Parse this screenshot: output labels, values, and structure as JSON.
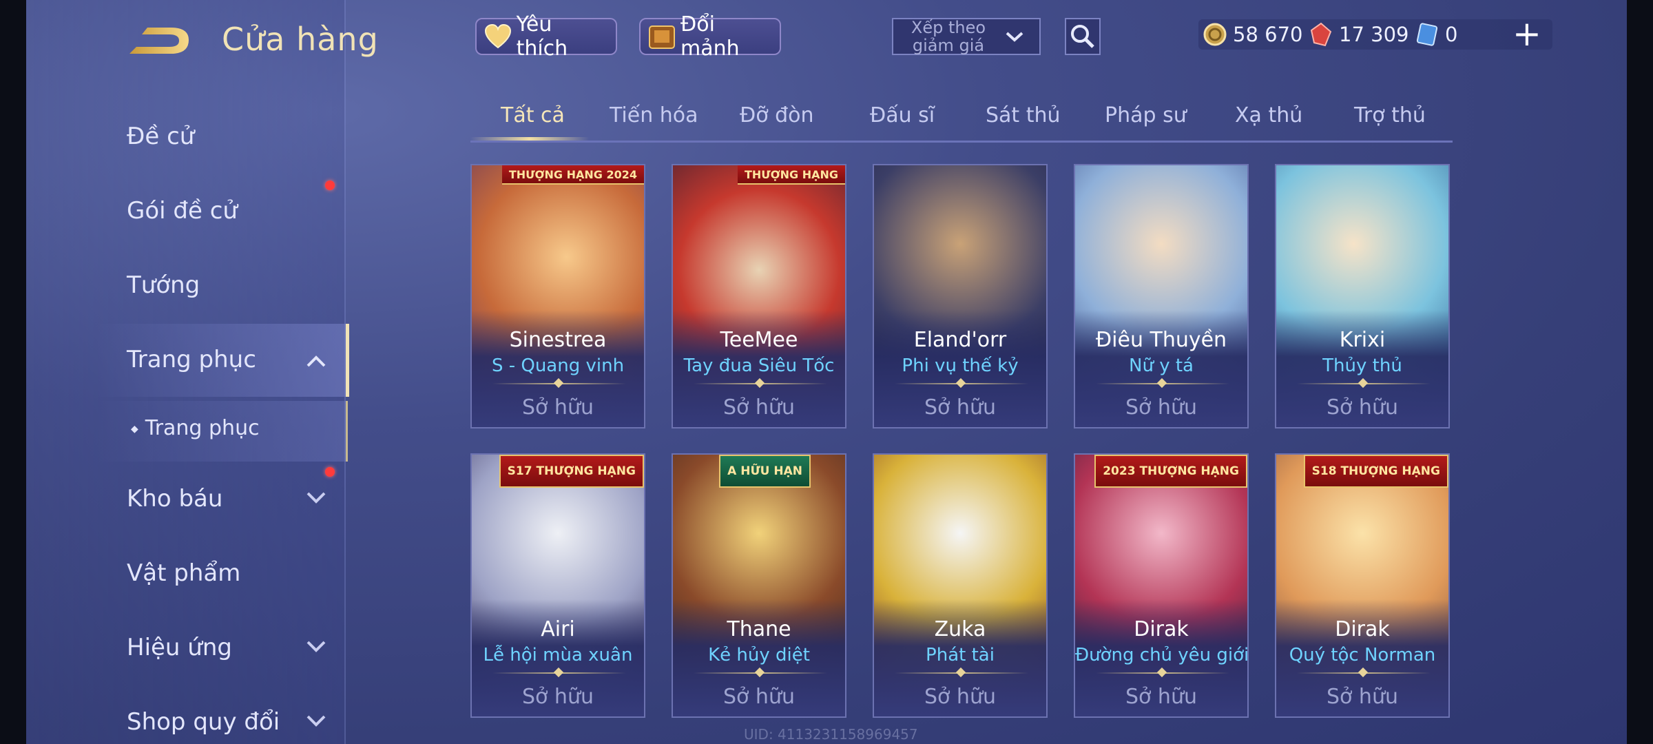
{
  "header": {
    "title": "Cửa hàng",
    "favorite_label": "Yêu thích",
    "exchange_label": "Đổi mảnh",
    "sort_label": "Xếp theo giảm giá",
    "currencies": [
      {
        "name": "gold-coin",
        "value": "58 670"
      },
      {
        "name": "ruby",
        "value": "17 309"
      },
      {
        "name": "voucher",
        "value": "0"
      }
    ],
    "add_label": "+"
  },
  "sidebar": {
    "items": [
      {
        "label": "Đề cử"
      },
      {
        "label": "Gói đề cử"
      },
      {
        "label": "Tướng"
      },
      {
        "label": "Trang phục"
      },
      {
        "label": "Trang phục"
      },
      {
        "label": "Kho báu"
      },
      {
        "label": "Vật phẩm"
      },
      {
        "label": "Hiệu ứng"
      },
      {
        "label": "Shop quy đổi"
      }
    ]
  },
  "tabs": [
    "Tất cả",
    "Tiến hóa",
    "Đỡ đòn",
    "Đấu sĩ",
    "Sát thủ",
    "Pháp sư",
    "Xạ thủ",
    "Trợ thủ"
  ],
  "cards": [
    {
      "hero": "Sinestrea",
      "skin": "S - Quang vinh",
      "status": "Sở hữu",
      "badge": "THƯỢNG HẠNG 2024"
    },
    {
      "hero": "TeeMee",
      "skin": "Tay đua Siêu Tốc",
      "status": "Sở hữu",
      "badge": "THƯỢNG HẠNG"
    },
    {
      "hero": "Eland'orr",
      "skin": "Phi vụ thế kỷ",
      "status": "Sở hữu",
      "badge": ""
    },
    {
      "hero": "Điêu Thuyền",
      "skin": "Nữ y tá",
      "status": "Sở hữu",
      "badge": ""
    },
    {
      "hero": "Krixi",
      "skin": "Thủy thủ",
      "status": "Sở hữu",
      "badge": ""
    },
    {
      "hero": "Airi",
      "skin": "Lễ hội mùa xuân",
      "status": "Sở hữu",
      "badge": "S17 THƯỢNG HẠNG"
    },
    {
      "hero": "Thane",
      "skin": "Kẻ hủy diệt",
      "status": "Sở hữu",
      "badge": "A HỮU HẠN"
    },
    {
      "hero": "Zuka",
      "skin": "Phát tài",
      "status": "Sở hữu",
      "badge": ""
    },
    {
      "hero": "Dirak",
      "skin": "Đường chủ yêu giới",
      "status": "Sở hữu",
      "badge": "2023 THƯỢNG HẠNG"
    },
    {
      "hero": "Dirak",
      "skin": "Quý tộc Norman",
      "status": "Sở hữu",
      "badge": "S18 THƯỢNG HẠNG"
    }
  ],
  "uid_text": "UID: 4113231158969457",
  "colors": {
    "accent_gold": "#f1e3b6",
    "skin_name": "#6fd3ff",
    "notification": "#ff3b3b"
  }
}
